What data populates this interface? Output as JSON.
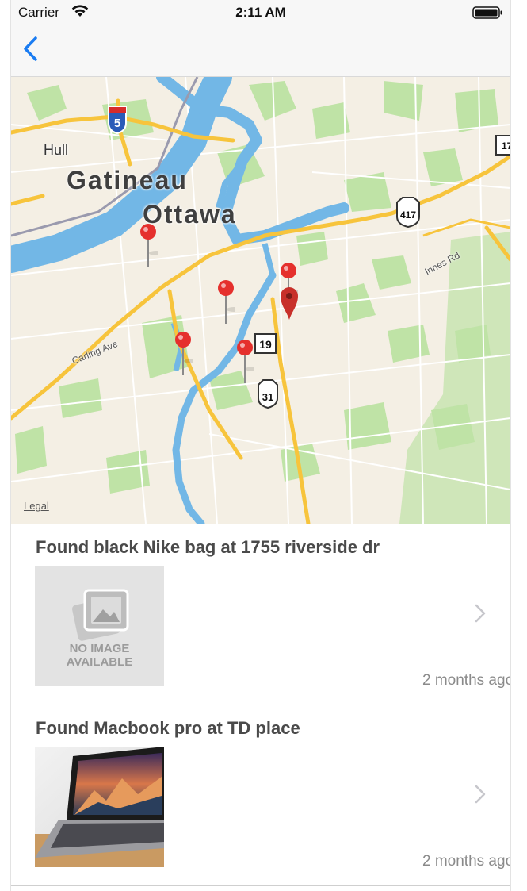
{
  "status_bar": {
    "carrier": "Carrier",
    "time": "2:11 AM"
  },
  "navigation": {
    "back_icon": "chevron-left-icon"
  },
  "map": {
    "city_labels": {
      "gatineau": "Gatineau",
      "ottawa": "Ottawa",
      "hull": "Hull"
    },
    "road_labels": {
      "carling": "Carling Ave",
      "innes": "Innes Rd"
    },
    "route_shields": {
      "interstate": "5",
      "hwy417": "417",
      "hwy19": "19",
      "hwy31": "31",
      "edge": "17"
    },
    "legal": "Legal",
    "pin_color": "#e5302d",
    "selected_pin_color": "#c8302a"
  },
  "items": [
    {
      "title": "Found black Nike bag at 1755 riverside dr",
      "image_placeholder": "NO IMAGE AVAILABLE",
      "date": "2 months ago"
    },
    {
      "title": "Found Macbook pro at TD place",
      "date": "2 months ago"
    }
  ],
  "colors": {
    "accent": "#1a7cf2",
    "chevron": "#c7c7cc"
  }
}
